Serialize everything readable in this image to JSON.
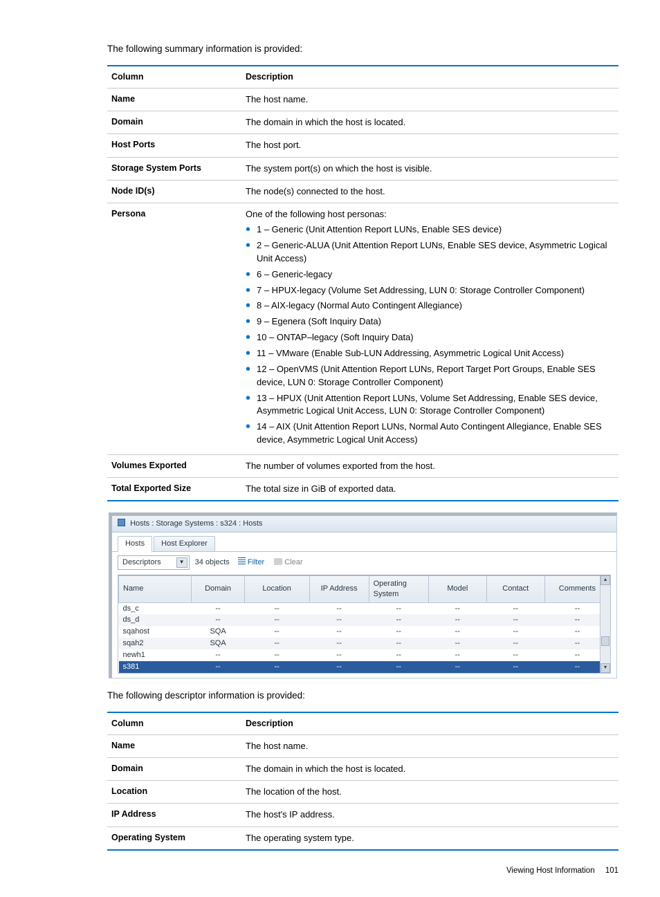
{
  "intro1": "The following summary information is provided:",
  "table1": {
    "header": {
      "col1": "Column",
      "col2": "Description"
    },
    "rows": {
      "name": {
        "label": "Name",
        "desc": "The host name."
      },
      "domain": {
        "label": "Domain",
        "desc": "The domain in which the host is located."
      },
      "hostports": {
        "label": "Host Ports",
        "desc": "The host port."
      },
      "sysports": {
        "label": "Storage System Ports",
        "desc": "The system port(s) on which the host is visible."
      },
      "nodeids": {
        "label": "Node ID(s)",
        "desc": "The node(s) connected to the host."
      },
      "persona": {
        "label": "Persona",
        "intro": "One of the following host personas:",
        "items": [
          "1 – Generic (Unit Attention Report LUNs, Enable SES device)",
          "2 – Generic-ALUA (Unit Attention Report LUNs, Enable SES device, Asymmetric Logical Unit Access)",
          "6 – Generic-legacy",
          "7 – HPUX-legacy (Volume Set Addressing, LUN 0: Storage Controller Component)",
          "8 – AIX-legacy (Normal Auto Contingent Allegiance)",
          "9 – Egenera (Soft Inquiry Data)",
          "10 – ONTAP–legacy (Soft Inquiry Data)",
          "11 – VMware (Enable Sub-LUN Addressing, Asymmetric Logical Unit Access)",
          "12 – OpenVMS (Unit Attention Report LUNs, Report Target Port Groups, Enable SES device, LUN 0: Storage Controller Component)",
          "13 – HPUX (Unit Attention Report LUNs, Volume Set Addressing, Enable SES device, Asymmetric Logical Unit Access, LUN 0: Storage Controller Component)",
          "14 – AIX (Unit Attention Report LUNs, Normal Auto Contingent Allegiance, Enable SES device, Asymmetric Logical Unit Access)"
        ]
      },
      "volexp": {
        "label": "Volumes Exported",
        "desc": "The number of volumes exported from the host."
      },
      "totalexp": {
        "label": "Total Exported Size",
        "desc": "The total size in GiB of exported data."
      }
    }
  },
  "shot": {
    "title": "Hosts : Storage Systems : s324 : Hosts",
    "tabs": {
      "hosts": "Hosts",
      "explorer": "Host Explorer"
    },
    "toolbar": {
      "combo": "Descriptors",
      "count": "34 objects",
      "filter": "Filter",
      "clear": "Clear"
    },
    "headers": {
      "name": "Name",
      "domain": "Domain",
      "location": "Location",
      "ip": "IP Address",
      "os": "Operating System",
      "model": "Model",
      "contact": "Contact",
      "comments": "Comments"
    },
    "rows": [
      {
        "name": "ds_c",
        "domain": "--",
        "location": "--",
        "ip": "--",
        "os": "--",
        "model": "--",
        "contact": "--",
        "comments": "--"
      },
      {
        "name": "ds_d",
        "domain": "--",
        "location": "--",
        "ip": "--",
        "os": "--",
        "model": "--",
        "contact": "--",
        "comments": "--"
      },
      {
        "name": "sqahost",
        "domain": "SQA",
        "location": "--",
        "ip": "--",
        "os": "--",
        "model": "--",
        "contact": "--",
        "comments": "--"
      },
      {
        "name": "sqah2",
        "domain": "SQA",
        "location": "--",
        "ip": "--",
        "os": "--",
        "model": "--",
        "contact": "--",
        "comments": "--"
      },
      {
        "name": "newh1",
        "domain": "--",
        "location": "--",
        "ip": "--",
        "os": "--",
        "model": "--",
        "contact": "--",
        "comments": "--"
      },
      {
        "name": "s381",
        "domain": "--",
        "location": "--",
        "ip": "--",
        "os": "--",
        "model": "--",
        "contact": "--",
        "comments": "--"
      }
    ]
  },
  "intro2": "The following descriptor information is provided:",
  "table2": {
    "header": {
      "col1": "Column",
      "col2": "Description"
    },
    "rows": {
      "name": {
        "label": "Name",
        "desc": "The host name."
      },
      "domain": {
        "label": "Domain",
        "desc": "The domain in which the host is located."
      },
      "location": {
        "label": "Location",
        "desc": "The location of the host."
      },
      "ip": {
        "label": "IP Address",
        "desc": "The host's IP address."
      },
      "os": {
        "label": "Operating System",
        "desc": "The operating system type."
      }
    }
  },
  "footer": {
    "section": "Viewing Host Information",
    "page": "101"
  }
}
